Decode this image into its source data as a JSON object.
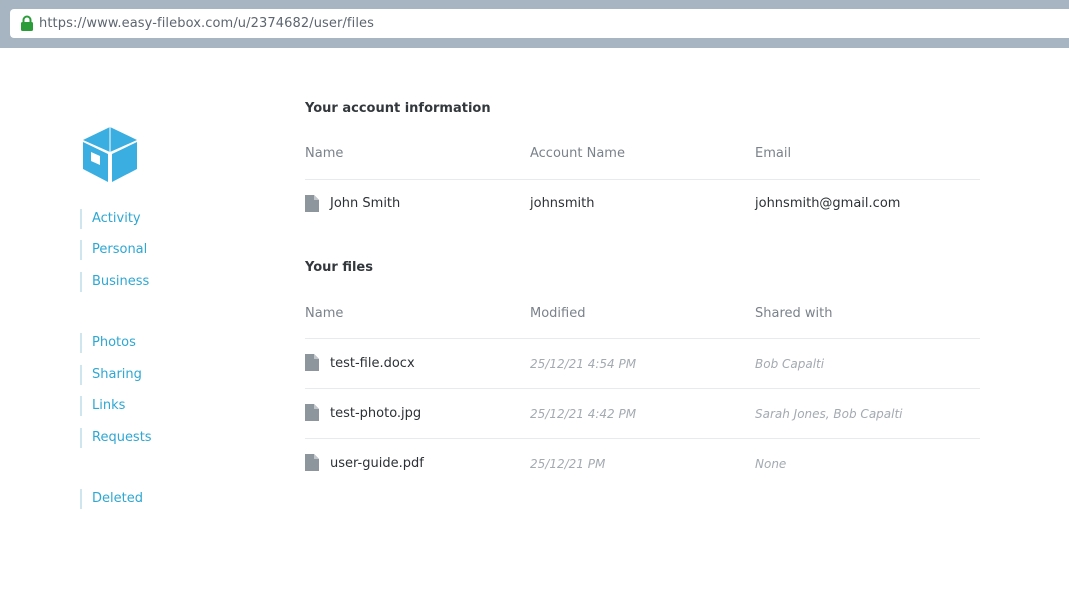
{
  "browser": {
    "url": "https://www.easy-filebox.com/u/2374682/user/files"
  },
  "sidebar": {
    "items": [
      {
        "label": "Activity"
      },
      {
        "label": "Personal"
      },
      {
        "label": "Business"
      },
      {
        "label": "Photos"
      },
      {
        "label": "Sharing"
      },
      {
        "label": "Links"
      },
      {
        "label": "Requests"
      },
      {
        "label": "Deleted"
      }
    ]
  },
  "account": {
    "title": "Your account information",
    "headers": {
      "name": "Name",
      "account_name": "Account Name",
      "email": "Email"
    },
    "row": {
      "name": "John Smith",
      "account_name": "johnsmith",
      "email": "johnsmith@gmail.com"
    }
  },
  "files": {
    "title": "Your files",
    "headers": {
      "name": "Name",
      "modified": "Modified",
      "shared_with": "Shared with"
    },
    "rows": [
      {
        "name": "test-file.docx",
        "modified": "25/12/21 4:54 PM",
        "shared_with": "Bob Capalti"
      },
      {
        "name": "test-photo.jpg",
        "modified": "25/12/21 4:42 PM",
        "shared_with": "Sarah Jones, Bob Capalti"
      },
      {
        "name": "user-guide.pdf",
        "modified": "25/12/21 PM",
        "shared_with": "None"
      }
    ]
  },
  "colors": {
    "accent": "#2ea7d3",
    "logo": "#3aaee0",
    "browser_bar": "#a7b4c2",
    "lock": "#2c9c3b",
    "file_icon": "#8d959d"
  },
  "icons": {
    "lock": "lock-icon",
    "logo": "box-logo-icon",
    "file": "document-icon"
  }
}
